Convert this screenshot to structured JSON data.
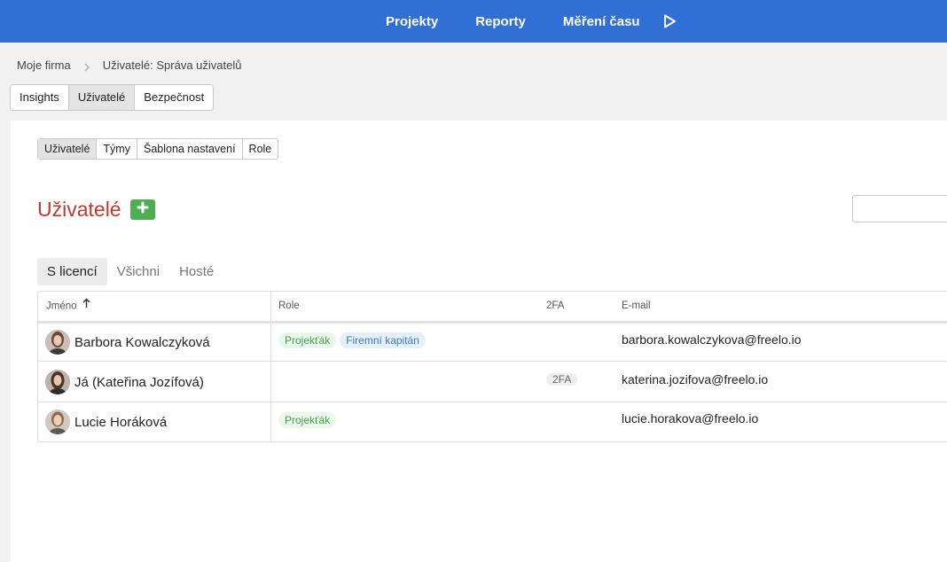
{
  "topnav": {
    "items": [
      "Projekty",
      "Reporty",
      "Měření času"
    ],
    "play_icon": "play-icon",
    "background": "#2f6fd6"
  },
  "breadcrumb": {
    "items": [
      "Moje firma",
      "Uživatelé: Správa uživatelů"
    ]
  },
  "main_tabs": [
    "Insights",
    "Uživatelé",
    "Bezpečnost"
  ],
  "main_tabs_active": "Uživatelé",
  "sub_tabs": [
    "Uživatelé",
    "Týmy",
    "Šablona nastavení",
    "Role"
  ],
  "sub_tabs_active": "Uživatelé",
  "page": {
    "title": "Uživatelé",
    "title_color": "#c0392b",
    "add_icon": "plus-icon",
    "add_color": "#4caf50",
    "search_value": ""
  },
  "filters": [
    "S licencí",
    "Všichni",
    "Hosté"
  ],
  "filters_active": "S licencí",
  "table": {
    "columns": [
      "Jméno",
      "Role",
      "2FA",
      "E-mail"
    ],
    "sort_icon": "arrow-up-icon",
    "rows": [
      {
        "name": "Barbora Kowalczyková",
        "roles": [
          {
            "label": "Projekťák",
            "color": "green"
          },
          {
            "label": "Firemní kapitán",
            "color": "blue"
          }
        ],
        "twofa": "",
        "email": "barbora.kowalczykova@freelo.io"
      },
      {
        "name": "Já (Kateřina Jozífová)",
        "roles": [],
        "twofa": "2FA",
        "email": "katerina.jozifova@freelo.io"
      },
      {
        "name": "Lucie Horáková",
        "roles": [
          {
            "label": "Projekťák",
            "color": "green"
          }
        ],
        "twofa": "",
        "email": "lucie.horakova@freelo.io"
      }
    ]
  }
}
